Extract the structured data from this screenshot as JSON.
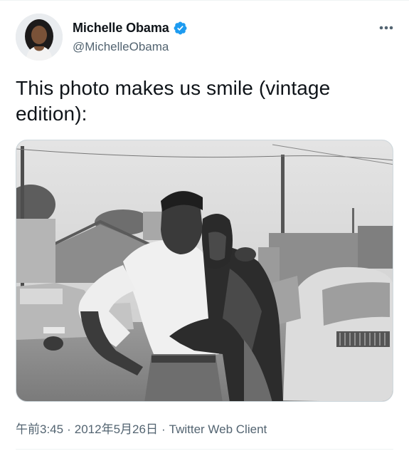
{
  "tweet": {
    "author": {
      "display_name": "Michelle Obama",
      "handle": "@MichelleObama",
      "verified": true,
      "verified_icon": "verified-badge-icon",
      "verified_color": "#1d9bf0",
      "avatar_icon": "profile-avatar"
    },
    "more_icon": "more-horizontal-icon",
    "text": "This photo makes us smile (vintage edition):",
    "media_icon": "vintage-black-and-white-photo",
    "meta": {
      "time": "午前3:45",
      "separator": "·",
      "date": "2012年5月26日",
      "client": "Twitter Web Client"
    }
  },
  "colors": {
    "text_primary": "#0f1419",
    "text_secondary": "#536471",
    "accent": "#1d9bf0",
    "border": "#cfd9de"
  }
}
